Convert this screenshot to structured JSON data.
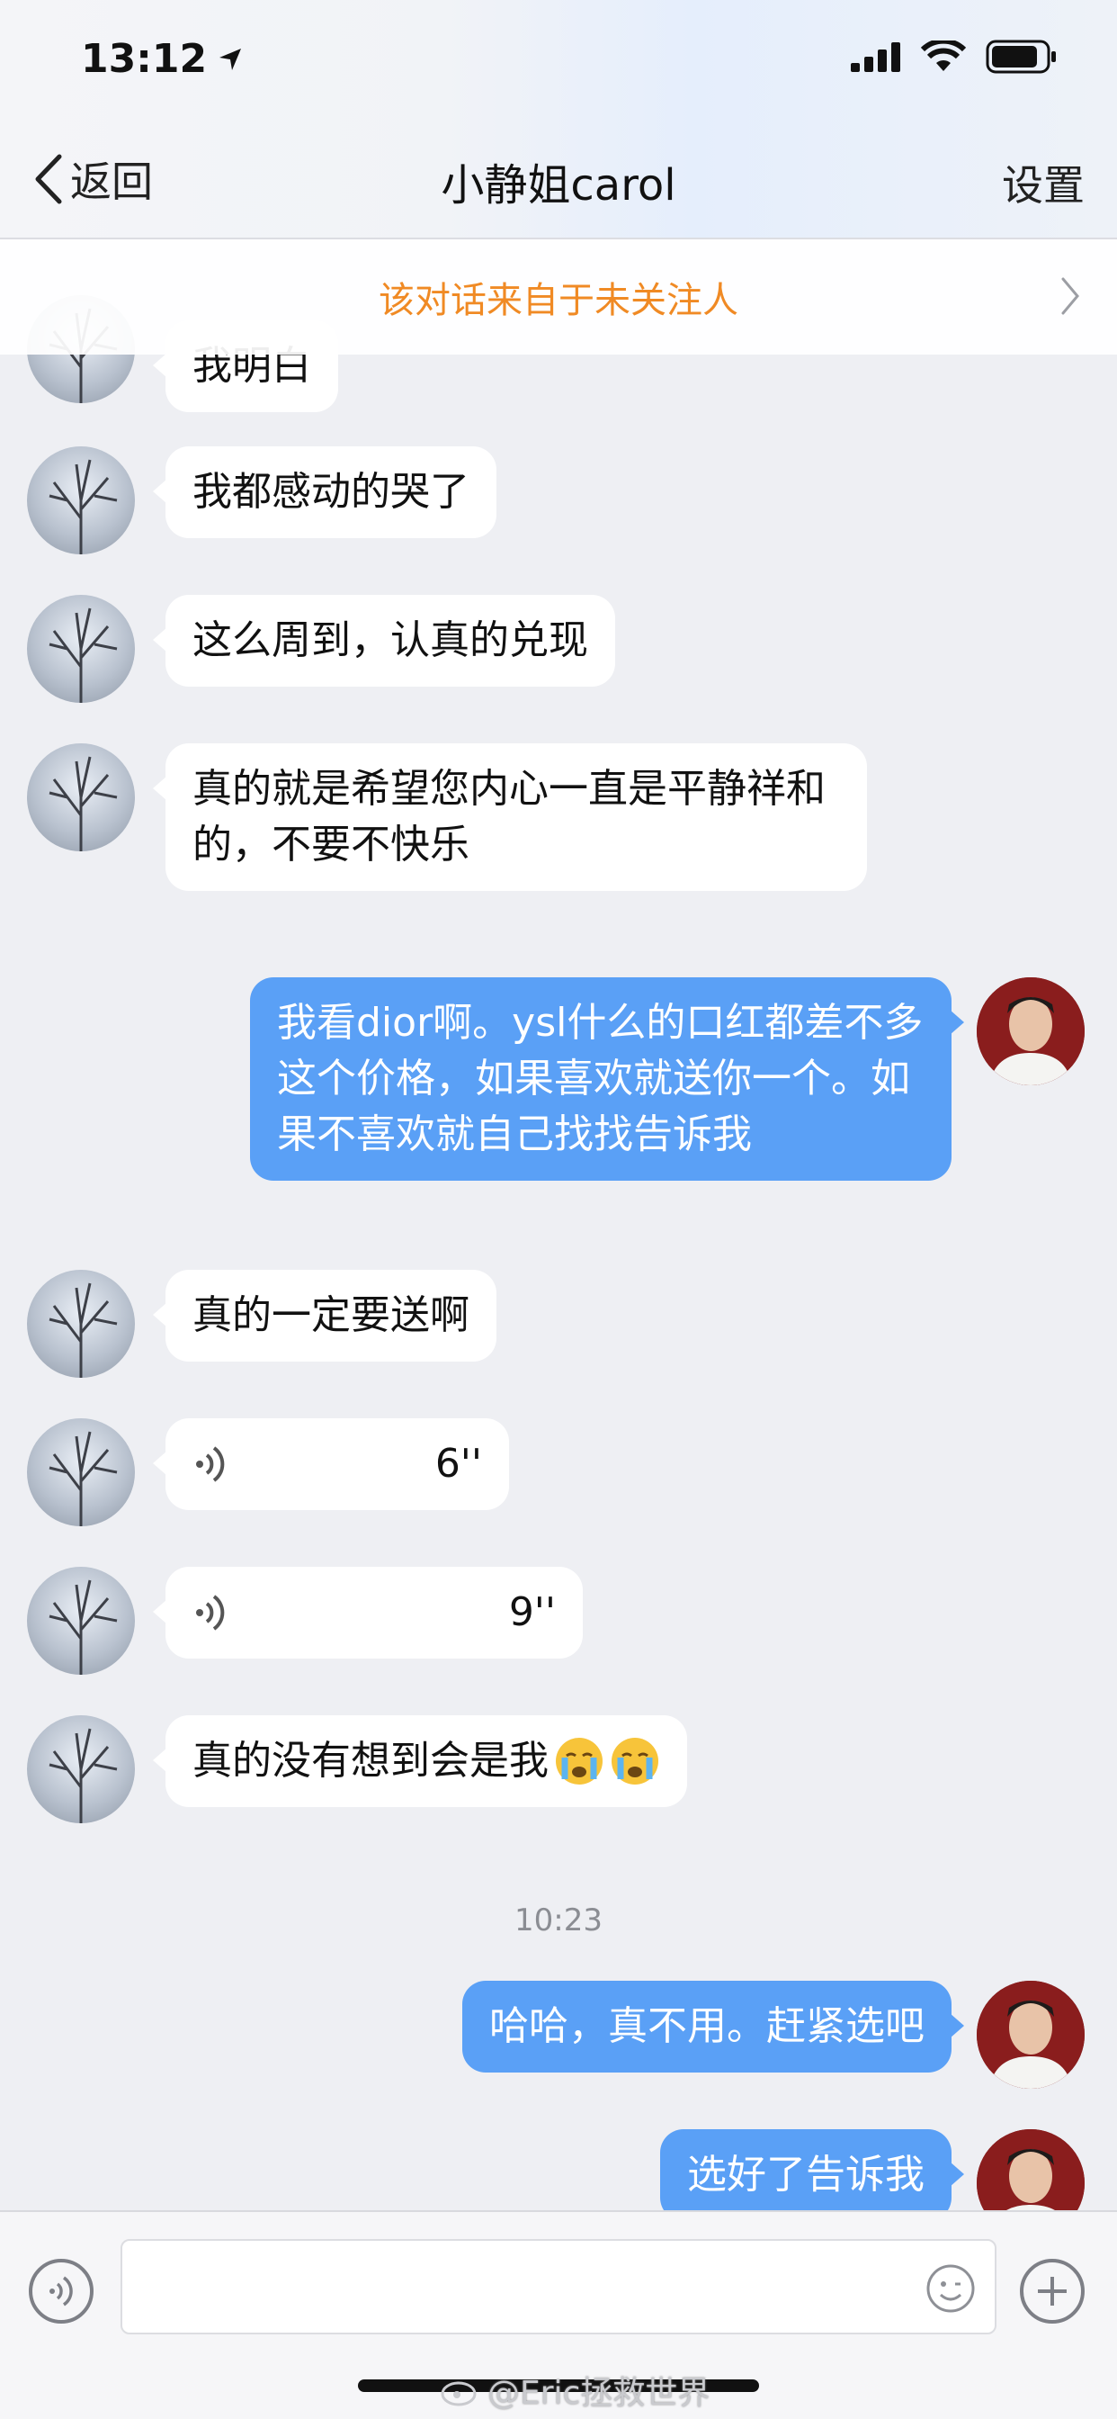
{
  "status_bar": {
    "time": "13:12"
  },
  "nav": {
    "back_label": "返回",
    "title": "小静姐carol",
    "settings_label": "设置"
  },
  "notice": {
    "text": "该对话来自于未关注人"
  },
  "messages": [
    {
      "from": "other",
      "text": "我明白"
    },
    {
      "from": "other",
      "text": "我都感动的哭了"
    },
    {
      "from": "other",
      "text": "这么周到，认真的兑现"
    },
    {
      "from": "other",
      "text": "真的就是希望您内心一直是平静祥和的，不要不快乐"
    },
    {
      "from": "me",
      "text": "我看dior啊。ysl什么的口红都差不多这个价格，如果喜欢就送你一个。如果不喜欢就自己找找告诉我"
    },
    {
      "from": "other",
      "text": "真的一定要送啊"
    },
    {
      "from": "other",
      "type": "voice",
      "duration": "6''"
    },
    {
      "from": "other",
      "type": "voice",
      "duration": "9''"
    },
    {
      "from": "other",
      "text": "真的没有想到会是我",
      "emoji": "crying-face-icon"
    },
    {
      "type": "timestamp",
      "text": "10:23"
    },
    {
      "from": "me",
      "text": "哈哈，真不用。赶紧选吧"
    },
    {
      "from": "me",
      "text": "选好了告诉我"
    }
  ],
  "watermark": {
    "text": "@Eric拯救世界"
  },
  "colors": {
    "accent": "#5aa0f6",
    "notice": "#f08a24",
    "background": "#eeeff3"
  }
}
